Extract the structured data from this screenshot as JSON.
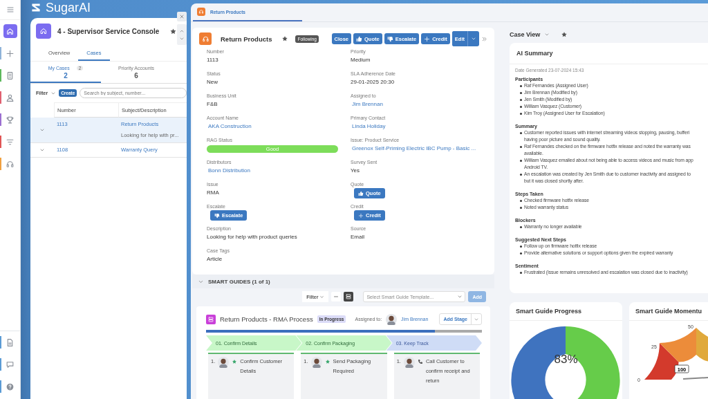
{
  "rail": {
    "items": [
      {
        "kind": "home",
        "selected": true
      },
      {
        "kind": "plus",
        "selected": false,
        "color": "#8fb3d9"
      },
      {
        "kind": "building",
        "selected": false,
        "color": "#5cb85c"
      },
      {
        "kind": "person",
        "selected": false,
        "color": "#e06070"
      },
      {
        "kind": "trophy",
        "selected": false,
        "color": "#9b6fd0"
      },
      {
        "kind": "filter",
        "selected": false,
        "color": "#e05555"
      },
      {
        "kind": "headset",
        "selected": false,
        "color": "#f0a040"
      }
    ],
    "bottom": [
      {
        "kind": "document",
        "selected": false,
        "color": "#5b9bd5"
      },
      {
        "kind": "chat",
        "selected": false,
        "color": "#5b9bd5"
      },
      {
        "kind": "help",
        "selected": false,
        "color": "#5b9bd5"
      }
    ]
  },
  "app": {
    "name": "SugarAI"
  },
  "console": {
    "title": "4 - Supervisor Service Console",
    "tabs": [
      {
        "label": "Overview",
        "selected": false
      },
      {
        "label": "Cases",
        "selected": true
      }
    ],
    "subtabs": [
      {
        "label": "My Cases",
        "badge": "2",
        "count": "2",
        "selected": true
      },
      {
        "label": "Priority Accounts",
        "count": "6",
        "selected": false
      }
    ],
    "filter": "Filter",
    "create": "Create",
    "search": {
      "placeholder": "Search by subject, number..."
    },
    "columns": [
      "Number",
      "Subject/Description"
    ],
    "rows": [
      {
        "number": "1113",
        "subject": "Return Products",
        "description": "Looking for help with pr...",
        "selected": true
      },
      {
        "number": "1108",
        "subject": "Warranty Query",
        "selected": false
      }
    ]
  },
  "record_tab": {
    "label": "Return Products",
    "selected": true
  },
  "record": {
    "title": "Return Products",
    "following": "Following",
    "actions": [
      {
        "kind": "plain",
        "label": "Close"
      },
      {
        "kind": "thumbs-up",
        "label": "Quote"
      },
      {
        "kind": "thumbs-down",
        "label": "Escalate"
      },
      {
        "kind": "plus",
        "label": "Credit"
      },
      {
        "kind": "split",
        "label": "Edit"
      }
    ],
    "fields": [
      {
        "label": "Number",
        "kind": "text",
        "value": "1113"
      },
      {
        "label": "Priority",
        "kind": "text",
        "value": "Medium"
      },
      {
        "label": "Status",
        "kind": "text",
        "value": "New"
      },
      {
        "label": "SLA Adherence Date",
        "kind": "text",
        "value": "29-01-2025 20:30"
      },
      {
        "label": "Business Unit",
        "kind": "text",
        "value": "F&B"
      },
      {
        "label": "Assigned to",
        "kind": "link",
        "value": "Jim Brennan"
      },
      {
        "label": "Account Name",
        "kind": "link",
        "value": "AKA Construction"
      },
      {
        "label": "Primary Contact",
        "kind": "link",
        "value": "Linda Holiday"
      },
      {
        "label": "RAG Status",
        "kind": "status",
        "value": "Good",
        "color": "#7ddd5a"
      },
      {
        "label": "Issue: Product Service",
        "kind": "link",
        "value": "Greenox Self-Priming Electric IBC Pump - Basic ..."
      },
      {
        "label": "Distributors",
        "kind": "link",
        "value": "Bonn Distribution"
      },
      {
        "label": "Survey Sent",
        "kind": "text",
        "value": "Yes"
      },
      {
        "label": "Issue",
        "kind": "text",
        "value": "RMA"
      },
      {
        "label": "Quote",
        "kind": "like",
        "value": "Quote"
      },
      {
        "label": "Escalate",
        "kind": "dislike",
        "value": "Escalate"
      },
      {
        "label": "Credit",
        "kind": "add",
        "value": "Credit"
      },
      {
        "label": "Description",
        "kind": "text",
        "value": "Looking for help with product queries"
      },
      {
        "label": "Source",
        "kind": "text",
        "value": "Email"
      },
      {
        "label": "Case Tags",
        "kind": "text",
        "value": "Article"
      }
    ]
  },
  "smart_guides": {
    "title": "SMART GUIDES (1 of 1)",
    "expanded": true,
    "filter": "Filter",
    "view_modes": [
      {
        "kind": "list",
        "selected": false
      },
      {
        "kind": "tiles",
        "selected": true
      }
    ],
    "template": {
      "placeholder": "Select Smart Guide Template..."
    },
    "add": {
      "label": "Add",
      "disabled": true
    },
    "guide": {
      "title": "Return Products - RMA Process",
      "status": "In Progress",
      "assigned_label": "Assigned to:",
      "assignee": "Jim Brennan",
      "add_stage": "Add Stage",
      "progress": {
        "level": 0.83
      },
      "stages": [
        {
          "label": "01. Confirm Details",
          "completed": true,
          "task": {
            "number": "1.",
            "kind": "star",
            "title": "Confirm Customer Details"
          }
        },
        {
          "label": "02. Confirm Packaging",
          "completed": true,
          "task": {
            "number": "1.",
            "kind": "star",
            "title": "Send Packaging Required"
          }
        },
        {
          "label": "03. Keep Track",
          "completed": false,
          "task": {
            "number": "1.",
            "kind": "call",
            "title": "Call Customer to confirm receipt and return"
          }
        }
      ]
    }
  },
  "case_view": {
    "title": "Case View"
  },
  "ai_summary": {
    "title": "AI Summary",
    "date": "Date Generated 23-07-2024 15:43",
    "sections": [
      {
        "heading": "Participants",
        "items": [
          [
            "Raf Fernandes (Assigned User)"
          ],
          [
            "Jim Brennan (Modified by)"
          ],
          [
            "Jen Smith (Modified by)"
          ],
          [
            "William Vasquez (Customer)"
          ],
          [
            "Kim Troy (Assigned User for Escalation)"
          ]
        ]
      },
      {
        "heading": "Summary",
        "items": [
          [
            "Customer reported issues with internet streaming videos stopping, pausing, bufferi",
            "having poor picture and sound quality."
          ],
          [
            "Raf Fernandes checked on the firmware hotfix release and noted the warranty was",
            "available."
          ],
          [
            "William Vasquez emailed about not being able to access videos and music from app",
            "Android TV."
          ],
          [
            "An escalation was created by Jen Smith due to customer inactivity and assigned to",
            "but it was closed shortly after."
          ]
        ]
      },
      {
        "heading": "Steps Taken",
        "items": [
          [
            "Checked firmware hotfix release"
          ],
          [
            "Noted warranty status"
          ]
        ]
      },
      {
        "heading": "Blockers",
        "items": [
          [
            "Warranty no longer available"
          ]
        ]
      },
      {
        "heading": "Suggested Next Steps",
        "items": [
          [
            "Follow up on firmware hotfix release"
          ],
          [
            "Provide alternative solutions or support options given the expired warranty"
          ]
        ]
      },
      {
        "heading": "Sentiment",
        "items": [
          [
            "Frustrated (Issue remains unresolved and escalation was closed due to inactivity)"
          ]
        ]
      }
    ]
  },
  "dashlets": [
    {
      "kind": "donut",
      "title": "Smart Guide Progress",
      "center_label": "83%"
    },
    {
      "kind": "gauge",
      "title": "Smart Guide Momentu",
      "tick_labels": [
        "0",
        "25",
        "50"
      ],
      "value_label": "100"
    }
  ]
}
